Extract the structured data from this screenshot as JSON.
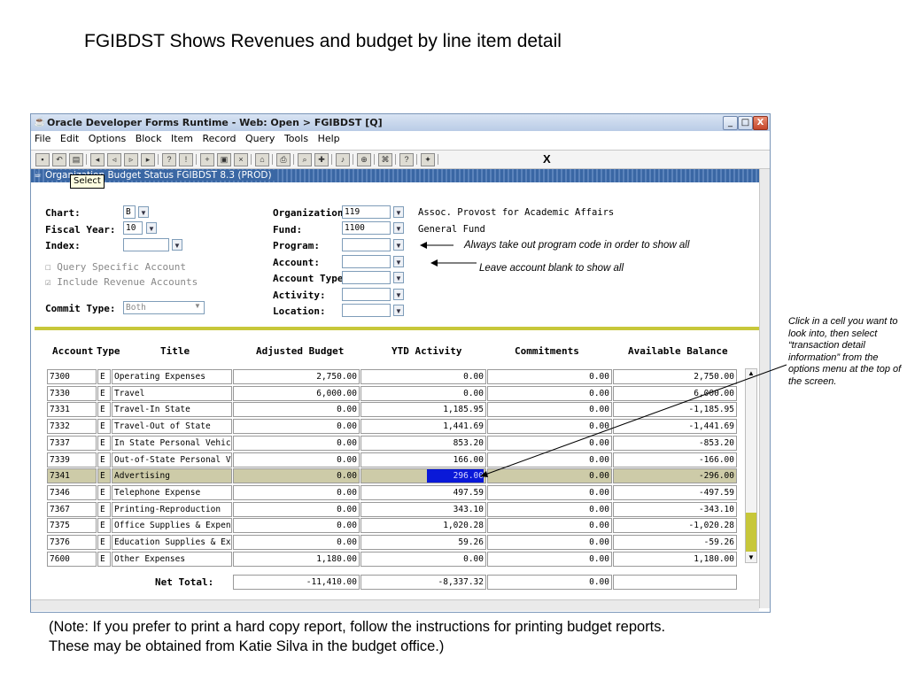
{
  "slide": {
    "title": "FGIBDST  Shows Revenues and budget by line item detail",
    "note_line1": "(Note: If you prefer to print a hard copy report, follow the instructions for printing budget reports.",
    "note_line2": "These may be obtained from Katie Silva in the budget office.)",
    "annotation": "Click in a cell you want to look into, then select “transaction detail information” from the options menu at the top of the screen."
  },
  "window": {
    "title": "Oracle Developer Forms Runtime - Web:  Open > FGIBDST [Q]",
    "controls": {
      "minimize": "_",
      "maximize": "□",
      "close": "X"
    }
  },
  "menu": [
    "File",
    "Edit",
    "Options",
    "Block",
    "Item",
    "Record",
    "Query",
    "Tools",
    "Help"
  ],
  "toolbar": {
    "exit_label": "X"
  },
  "form": {
    "title": "Organization Budget Status  FGIBDST  8.3  (PROD)",
    "tooltip": "Select"
  },
  "key_block": {
    "chart_label": "Chart:",
    "chart_value": "B",
    "fiscal_year_label": "Fiscal Year:",
    "fiscal_year_value": "10",
    "index_label": "Index:",
    "index_value": "",
    "query_specific_label": "Query Specific Account",
    "query_specific_checked": false,
    "include_revenue_label": "Include Revenue Accounts",
    "include_revenue_checked": true,
    "commit_type_label": "Commit Type:",
    "commit_type_value": "Both",
    "organization_label": "Organization:",
    "organization_value": "119",
    "organization_desc": "Assoc. Provost for Academic Affairs",
    "fund_label": "Fund:",
    "fund_value": "1100",
    "fund_desc": "General Fund",
    "program_label": "Program:",
    "program_value": "",
    "account_label": "Account:",
    "account_value": "",
    "account_type_label": "Account Type:",
    "account_type_value": "",
    "activity_label": "Activity:",
    "activity_value": "",
    "location_label": "Location:",
    "location_value": "",
    "program_note": "Always take out program code in order to show all",
    "account_note": "Leave account blank to show all"
  },
  "table": {
    "headers": {
      "account": "Account",
      "type": "Type",
      "title": "Title",
      "adjusted_budget": "Adjusted Budget",
      "ytd_activity": "YTD Activity",
      "commitments": "Commitments",
      "available_balance": "Available Balance"
    },
    "rows": [
      {
        "account": "7300",
        "type": "E",
        "title": "Operating Expenses",
        "budget": "2,750.00",
        "ytd": "0.00",
        "commit": "0.00",
        "avail": "2,750.00"
      },
      {
        "account": "7330",
        "type": "E",
        "title": "Travel",
        "budget": "6,000.00",
        "ytd": "0.00",
        "commit": "0.00",
        "avail": "6,000.00"
      },
      {
        "account": "7331",
        "type": "E",
        "title": "Travel-In State",
        "budget": "0.00",
        "ytd": "1,185.95",
        "commit": "0.00",
        "avail": "-1,185.95"
      },
      {
        "account": "7332",
        "type": "E",
        "title": "Travel-Out of State",
        "budget": "0.00",
        "ytd": "1,441.69",
        "commit": "0.00",
        "avail": "-1,441.69"
      },
      {
        "account": "7337",
        "type": "E",
        "title": "In State Personal Vehicle R",
        "budget": "0.00",
        "ytd": "853.20",
        "commit": "0.00",
        "avail": "-853.20"
      },
      {
        "account": "7339",
        "type": "E",
        "title": "Out-of-State Personal Vehic",
        "budget": "0.00",
        "ytd": "166.00",
        "commit": "0.00",
        "avail": "-166.00"
      },
      {
        "account": "7341",
        "type": "E",
        "title": "Advertising",
        "budget": "0.00",
        "ytd": "296.00",
        "commit": "0.00",
        "avail": "-296.00"
      },
      {
        "account": "7346",
        "type": "E",
        "title": "Telephone Expense",
        "budget": "0.00",
        "ytd": "497.59",
        "commit": "0.00",
        "avail": "-497.59"
      },
      {
        "account": "7367",
        "type": "E",
        "title": "Printing-Reproduction",
        "budget": "0.00",
        "ytd": "343.10",
        "commit": "0.00",
        "avail": "-343.10"
      },
      {
        "account": "7375",
        "type": "E",
        "title": "Office Supplies & Expenses",
        "budget": "0.00",
        "ytd": "1,020.28",
        "commit": "0.00",
        "avail": "-1,020.28"
      },
      {
        "account": "7376",
        "type": "E",
        "title": "Education Supplies & Expen",
        "budget": "0.00",
        "ytd": "59.26",
        "commit": "0.00",
        "avail": "-59.26"
      },
      {
        "account": "7600",
        "type": "E",
        "title": "Other Expenses",
        "budget": "1,180.00",
        "ytd": "0.00",
        "commit": "0.00",
        "avail": "1,180.00"
      }
    ],
    "selected_row": 6,
    "net_total_label": "Net Total:",
    "net_total": {
      "budget": "-11,410.00",
      "ytd": "-8,337.32",
      "commit": "0.00",
      "avail": ""
    }
  }
}
